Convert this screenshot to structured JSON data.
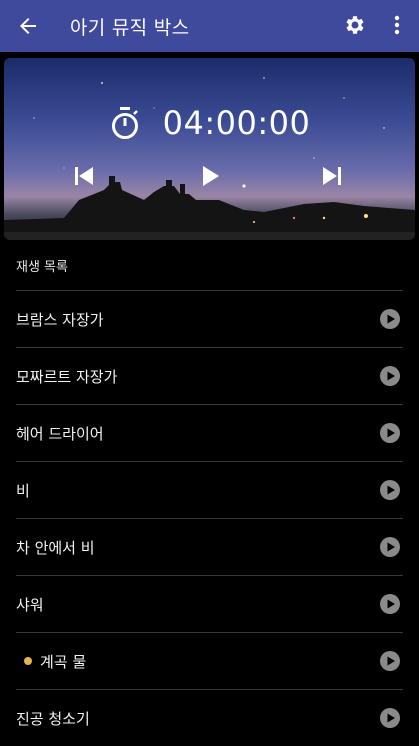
{
  "app": {
    "title": "아기 뮤직 박스"
  },
  "icons": {
    "back": "arrow-left-icon",
    "settings": "gear-icon",
    "more": "more-vert-icon"
  },
  "player": {
    "time": "04:00:00",
    "controls": [
      "skip-previous",
      "play",
      "skip-next"
    ]
  },
  "playlist": {
    "header": "재생 목록",
    "items": [
      {
        "label": "브람스 자장가",
        "active": false
      },
      {
        "label": "모짜르트 자장가",
        "active": false
      },
      {
        "label": "헤어 드라이어",
        "active": false
      },
      {
        "label": "비",
        "active": false
      },
      {
        "label": "차 안에서 비",
        "active": false
      },
      {
        "label": "샤워",
        "active": false
      },
      {
        "label": "계곡 물",
        "active": true
      },
      {
        "label": "진공 청소기",
        "active": false
      }
    ]
  },
  "colors": {
    "appbar": "#3f4a9c",
    "accent_dot": "#e3b54a",
    "background": "#000000"
  }
}
